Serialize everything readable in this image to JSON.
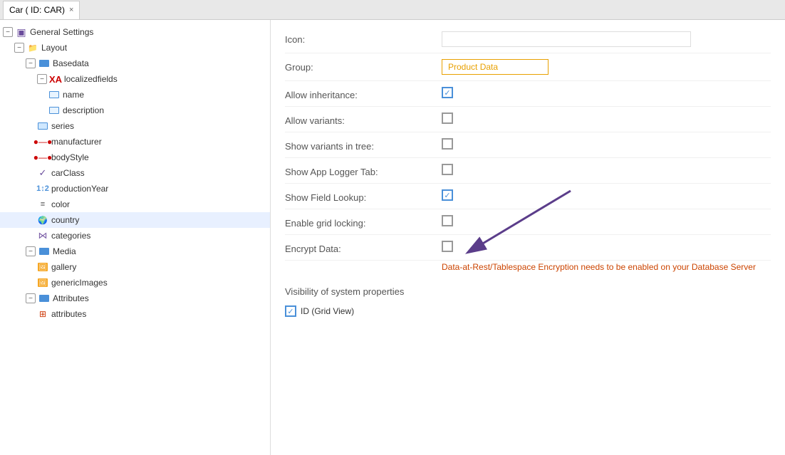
{
  "tab": {
    "label": "Car ( ID: CAR)",
    "close_label": "×"
  },
  "tree": {
    "items": [
      {
        "id": "general-settings",
        "label": "General Settings",
        "indent": 0,
        "icon": "database",
        "collapse": null
      },
      {
        "id": "layout",
        "label": "Layout",
        "indent": 1,
        "icon": "folder",
        "collapse": "minus"
      },
      {
        "id": "basedata",
        "label": "Basedata",
        "indent": 2,
        "icon": "blue-bar",
        "collapse": "minus"
      },
      {
        "id": "localizedfields",
        "label": "localizedfields",
        "indent": 3,
        "icon": "localized",
        "collapse": "minus"
      },
      {
        "id": "name",
        "label": "name",
        "indent": 4,
        "icon": "text-field"
      },
      {
        "id": "description",
        "label": "description",
        "indent": 4,
        "icon": "textarea"
      },
      {
        "id": "series",
        "label": "series",
        "indent": 3,
        "icon": "text-field"
      },
      {
        "id": "manufacturer",
        "label": "manufacturer",
        "indent": 3,
        "icon": "relation"
      },
      {
        "id": "bodyStyle",
        "label": "bodyStyle",
        "indent": 3,
        "icon": "relation"
      },
      {
        "id": "carClass",
        "label": "carClass",
        "indent": 3,
        "icon": "select"
      },
      {
        "id": "productionYear",
        "label": "productionYear",
        "indent": 3,
        "icon": "number"
      },
      {
        "id": "color",
        "label": "color",
        "indent": 3,
        "icon": "color-list"
      },
      {
        "id": "country",
        "label": "country",
        "indent": 3,
        "icon": "globe"
      },
      {
        "id": "categories",
        "label": "categories",
        "indent": 3,
        "icon": "share"
      },
      {
        "id": "media",
        "label": "Media",
        "indent": 2,
        "icon": "blue-bar",
        "collapse": "minus"
      },
      {
        "id": "gallery",
        "label": "gallery",
        "indent": 3,
        "icon": "image"
      },
      {
        "id": "genericImages",
        "label": "genericImages",
        "indent": 3,
        "icon": "image"
      },
      {
        "id": "attributes",
        "label": "Attributes",
        "indent": 2,
        "icon": "blue-bar",
        "collapse": "minus"
      },
      {
        "id": "attributes-item",
        "label": "attributes",
        "indent": 3,
        "icon": "grid"
      }
    ]
  },
  "form": {
    "icon_label": "Icon:",
    "icon_value": "/static/images/icons/car_gray.svg",
    "group_label": "Group:",
    "group_value": "Product Data",
    "allow_inheritance_label": "Allow inheritance:",
    "allow_inheritance_checked": true,
    "allow_variants_label": "Allow variants:",
    "allow_variants_checked": false,
    "show_variants_tree_label": "Show variants in tree:",
    "show_variants_tree_checked": false,
    "show_app_logger_label": "Show App Logger Tab:",
    "show_app_logger_checked": false,
    "show_field_lookup_label": "Show Field Lookup:",
    "show_field_lookup_checked": true,
    "enable_grid_locking_label": "Enable grid locking:",
    "enable_grid_locking_checked": false,
    "encrypt_data_label": "Encrypt Data:",
    "encrypt_data_checked": false,
    "encrypt_note_plain": "Data-at-Rest/Tablespace ",
    "encrypt_note_highlight": "Encryption needs to be enabled on your Database Server",
    "visibility_heading": "Visibility of system properties",
    "id_grid_view_label": "ID (Grid View)",
    "id_grid_view_checked": true
  },
  "colors": {
    "accent_blue": "#4a90d9",
    "accent_orange": "#e8a000",
    "accent_purple": "#6a4c9c",
    "arrow_color": "#5b3d8a"
  }
}
